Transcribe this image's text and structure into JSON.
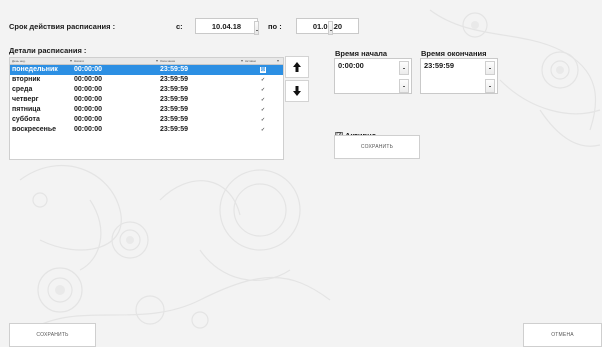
{
  "validity": {
    "title": "Срок действия расписания :",
    "from_label": "с:",
    "from_value": "10.04.18",
    "to_label": "по :",
    "to_value": "01.01.20"
  },
  "details": {
    "title": "Детали расписания :",
    "columns": [
      "День нед.",
      "Начало",
      "Окончание",
      "Активно"
    ],
    "rows": [
      {
        "day": "понедельник",
        "start": "00:00:00",
        "end": "23:59:59",
        "active": "☒",
        "selected": true
      },
      {
        "day": "вторник",
        "start": "00:00:00",
        "end": "23:59:59",
        "active": "✓",
        "selected": false
      },
      {
        "day": "среда",
        "start": "00:00:00",
        "end": "23:59:59",
        "active": "✓",
        "selected": false
      },
      {
        "day": "четверг",
        "start": "00:00:00",
        "end": "23:59:59",
        "active": "✓",
        "selected": false
      },
      {
        "day": "пятница",
        "start": "00:00:00",
        "end": "23:59:59",
        "active": "✓",
        "selected": false
      },
      {
        "day": "суббота",
        "start": "00:00:00",
        "end": "23:59:59",
        "active": "✓",
        "selected": false
      },
      {
        "day": "воскресенье",
        "start": "00:00:00",
        "end": "23:59:59",
        "active": "✓",
        "selected": false
      }
    ]
  },
  "editor": {
    "start_label": "Время начала",
    "start_value": "0:00:00",
    "end_label": "Время окончания",
    "end_value": "23:59:59",
    "active_label": "Активно",
    "active_mark": "☑",
    "save_label": "СОХРАНИТЬ"
  },
  "footer": {
    "save_label": "СОХРАНИТЬ",
    "cancel_label": "ОТМЕНА"
  },
  "icons": {
    "move_up": "arrow-up-icon",
    "move_down": "arrow-down-icon"
  },
  "colors": {
    "selection": "#2c8fe3",
    "background": "#f3f3f3"
  }
}
